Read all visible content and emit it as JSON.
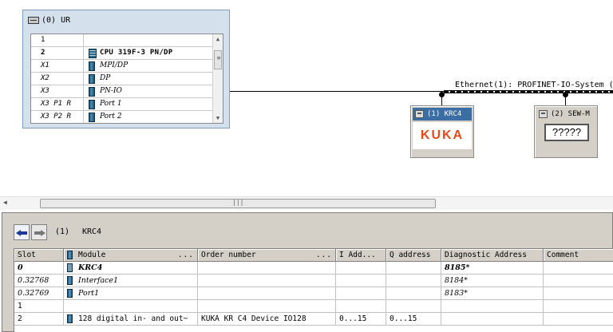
{
  "rack": {
    "title": "(0) UR",
    "rows": [
      {
        "slot": "1",
        "module": ""
      },
      {
        "slot": "2",
        "module": "CPU 319F-3 PN/DP"
      },
      {
        "slot": "X1",
        "module": "MPI/DP"
      },
      {
        "slot": "X2",
        "module": "DP"
      },
      {
        "slot": "X3",
        "module": "PN-IO"
      },
      {
        "slot": "X3 P1 R",
        "module": "Port 1"
      },
      {
        "slot": "X3 P2 R",
        "module": "Port 2"
      }
    ]
  },
  "network": {
    "label": "Ethernet(1): PROFINET-IO-System (",
    "devices": [
      {
        "label": "(1) KRC4",
        "logo": "KUKA"
      },
      {
        "label": "(2) SEW-M",
        "status": "?????"
      }
    ]
  },
  "detail": {
    "index": "(1)",
    "name": "KRC4",
    "columns": [
      "Slot",
      "Module",
      "Order number",
      "I Add...",
      "Q address",
      "Diagnostic Address",
      "Comment"
    ],
    "column_dots": "...",
    "rows": [
      {
        "slot": "0",
        "module": "KRC4",
        "order": "",
        "i_addr": "",
        "q_addr": "",
        "diag": "8185*",
        "comment": ""
      },
      {
        "slot": "0.32768",
        "module": "Interface1",
        "order": "",
        "i_addr": "",
        "q_addr": "",
        "diag": "8184*",
        "comment": ""
      },
      {
        "slot": "0.32769",
        "module": "Port1",
        "order": "",
        "i_addr": "",
        "q_addr": "",
        "diag": "8183*",
        "comment": ""
      },
      {
        "slot": "1",
        "module": "",
        "order": "",
        "i_addr": "",
        "q_addr": "",
        "diag": "",
        "comment": ""
      },
      {
        "slot": "2",
        "module": "128 digital in- and out~",
        "order": "KUKA KR C4 Device IO128",
        "i_addr": "0...15",
        "q_addr": "0...15",
        "diag": "",
        "comment": ""
      }
    ]
  },
  "icons": {
    "rack": "rack-icon",
    "module": "module-icon",
    "device": "device-icon",
    "back": "arrow-left-icon",
    "forward": "arrow-right-icon"
  },
  "colors": {
    "selection": "#3a6ea5",
    "kuka": "#e64a19",
    "panel": "#d4d0c8"
  }
}
